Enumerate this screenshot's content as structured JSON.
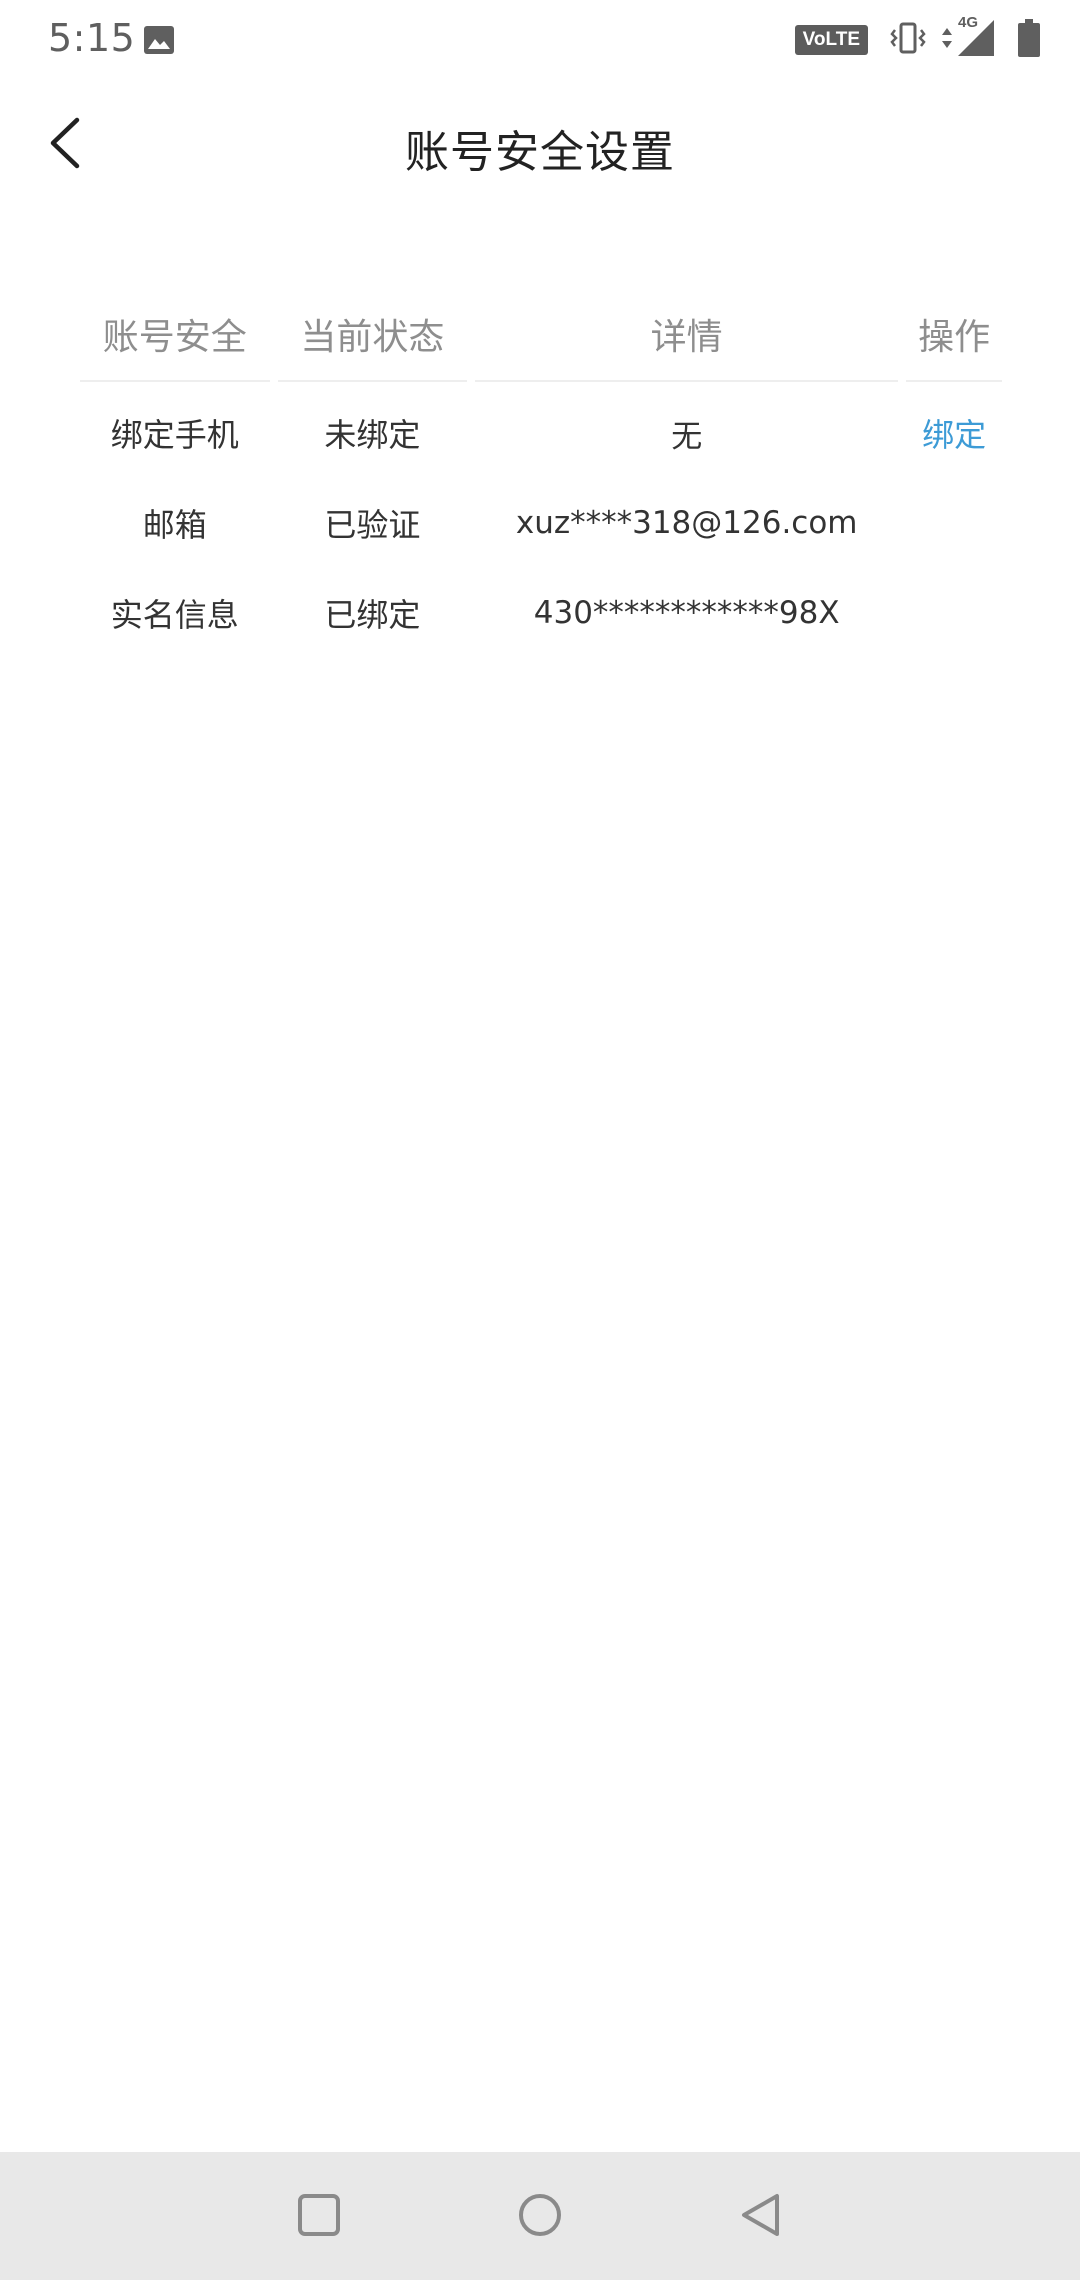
{
  "status_bar": {
    "time": "5:15",
    "volte_label": "VoLTE",
    "network_label": "4G"
  },
  "header": {
    "title": "账号安全设置"
  },
  "table": {
    "columns": [
      "账号安全",
      "当前状态",
      "详情",
      "操作"
    ],
    "rows": [
      {
        "item": "绑定手机",
        "status": "未绑定",
        "detail": "无",
        "action": "绑定"
      },
      {
        "item": "邮箱",
        "status": "已验证",
        "detail": "xuz****318@126.com",
        "action": ""
      },
      {
        "item": "实名信息",
        "status": "已绑定",
        "detail": "430************98X",
        "action": ""
      }
    ]
  },
  "colors": {
    "accent": "#3d9bd6",
    "text": "#333333",
    "header_text": "#8e8e8e",
    "nav_bar": "#e8e8e8"
  },
  "icons": {
    "back": "chevron-left-icon",
    "gallery": "image-icon",
    "vibrate": "vibrate-icon",
    "signal": "signal-icon",
    "battery": "battery-icon",
    "nav_recents": "square-icon",
    "nav_home": "circle-icon",
    "nav_back": "triangle-back-icon"
  }
}
